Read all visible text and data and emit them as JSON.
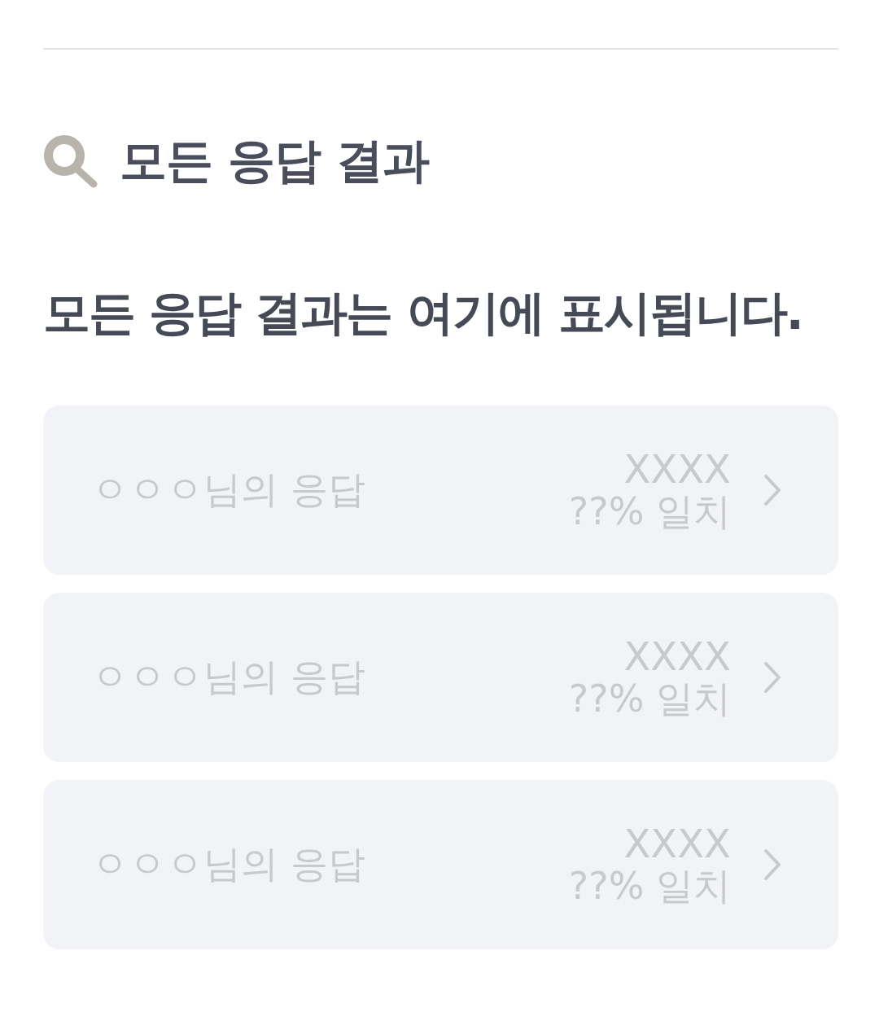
{
  "header": {
    "title": "모든 응답 결과"
  },
  "message": "모든 응답 결과는 여기에 표시됩니다.",
  "results": [
    {
      "label": "ㅇㅇㅇ님의 응답",
      "code": "XXXX",
      "match": "??% 일치"
    },
    {
      "label": "ㅇㅇㅇ님의 응답",
      "code": "XXXX",
      "match": "??% 일치"
    },
    {
      "label": "ㅇㅇㅇ님의 응답",
      "code": "XXXX",
      "match": "??% 일치"
    }
  ]
}
